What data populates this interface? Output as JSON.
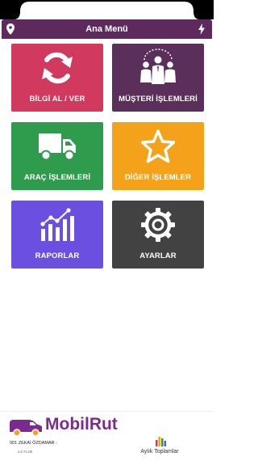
{
  "header": {
    "title": "Ana Menü",
    "left_icon": "location-pin-icon",
    "right_icon": "bolt-icon"
  },
  "tiles": [
    {
      "label": "BİLGİ AL / VER",
      "icon": "sync-icon",
      "color": "#d1395e"
    },
    {
      "label": "MÜŞTERİ İŞLEMLERİ",
      "icon": "customers-icon",
      "color": "#5a2f5a"
    },
    {
      "label": "ARAÇ İŞLEMLERİ",
      "icon": "truck-icon",
      "color": "#2f9b4d"
    },
    {
      "label": "DİĞER İŞLEMLER",
      "icon": "star-icon",
      "color": "#f5a21b"
    },
    {
      "label": "RAPORLAR",
      "icon": "bar-chart-icon",
      "color": "#6b4fe0"
    },
    {
      "label": "AYARLAR",
      "icon": "gear-icon",
      "color": "#424242"
    }
  ],
  "footer": {
    "brand": "MobilRut",
    "brand_color": "#7b2b8d",
    "user": "001 ZEKAİ ÖZDAMAR -",
    "version": "v.2.74.06",
    "monthly_label": "Aylık Toplamlar"
  }
}
